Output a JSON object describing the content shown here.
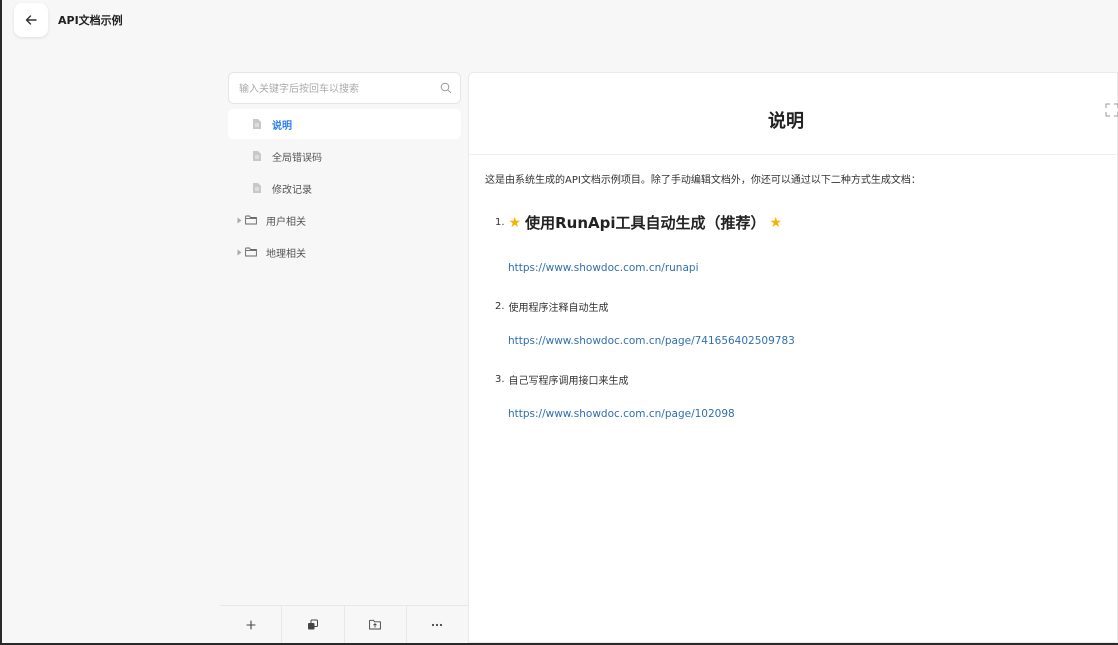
{
  "header": {
    "title": "API文档示例",
    "back_icon": "arrow-left-icon"
  },
  "sidebar": {
    "search": {
      "placeholder": "输入关键字后按回车以搜索",
      "value": ""
    },
    "items": [
      {
        "label": "说明",
        "type": "doc",
        "active": true
      },
      {
        "label": "全局错误码",
        "type": "doc"
      },
      {
        "label": "修改记录",
        "type": "doc"
      },
      {
        "label": "用户相关",
        "type": "folder"
      },
      {
        "label": "地理相关",
        "type": "folder"
      }
    ],
    "footer_icons": [
      "plus-icon",
      "copy-icon",
      "folder-upload-icon",
      "more-icon"
    ]
  },
  "document": {
    "title": "说明",
    "intro": "这是由系统生成的API文档示例项目。除了手动编辑文档外，你还可以通过以下二种方式生成文档：",
    "steps": [
      {
        "num": "1.",
        "text": "使用RunApi工具自动生成（推荐）",
        "link": "https://www.showdoc.com.cn/runapi"
      },
      {
        "num": "2.",
        "text": "使用程序注释自动生成",
        "link": "https://www.showdoc.com.cn/page/741656402509783"
      },
      {
        "num": "3.",
        "text": "自己写程序调用接口来生成",
        "link": "https://www.showdoc.com.cn/page/102098"
      }
    ],
    "star": "★"
  },
  "colors": {
    "accent": "#2f80ed",
    "link": "#2f6fb0",
    "star": "#f5b400"
  }
}
